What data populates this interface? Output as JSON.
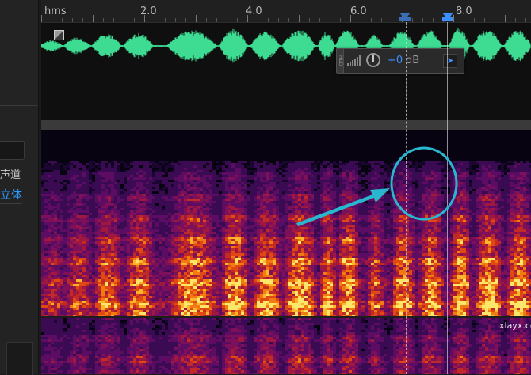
{
  "ruler": {
    "ticks": [
      {
        "id": "hms",
        "label": "hms"
      },
      {
        "id": "t2",
        "label": "2.0"
      },
      {
        "id": "t4",
        "label": "4.0"
      },
      {
        "id": "t6",
        "label": "6.0"
      },
      {
        "id": "t8",
        "label": "8.0"
      }
    ]
  },
  "left_panel": {
    "channel_label_partial": "声道",
    "channel_value_partial": "立体"
  },
  "hud": {
    "grip_label": "HUD",
    "value": "+0",
    "unit": "dB"
  },
  "watermark": {
    "domain": "xlayx.com"
  },
  "colors": {
    "waveform": "#3ddc92",
    "accent": "#3d8fff",
    "annotation": "#29b7cf"
  },
  "icons": {
    "clip_badge": "clip-corner-icon",
    "level_meter": "level-meter-icon",
    "volume_knob": "volume-knob-icon",
    "pin": "pin-icon"
  }
}
